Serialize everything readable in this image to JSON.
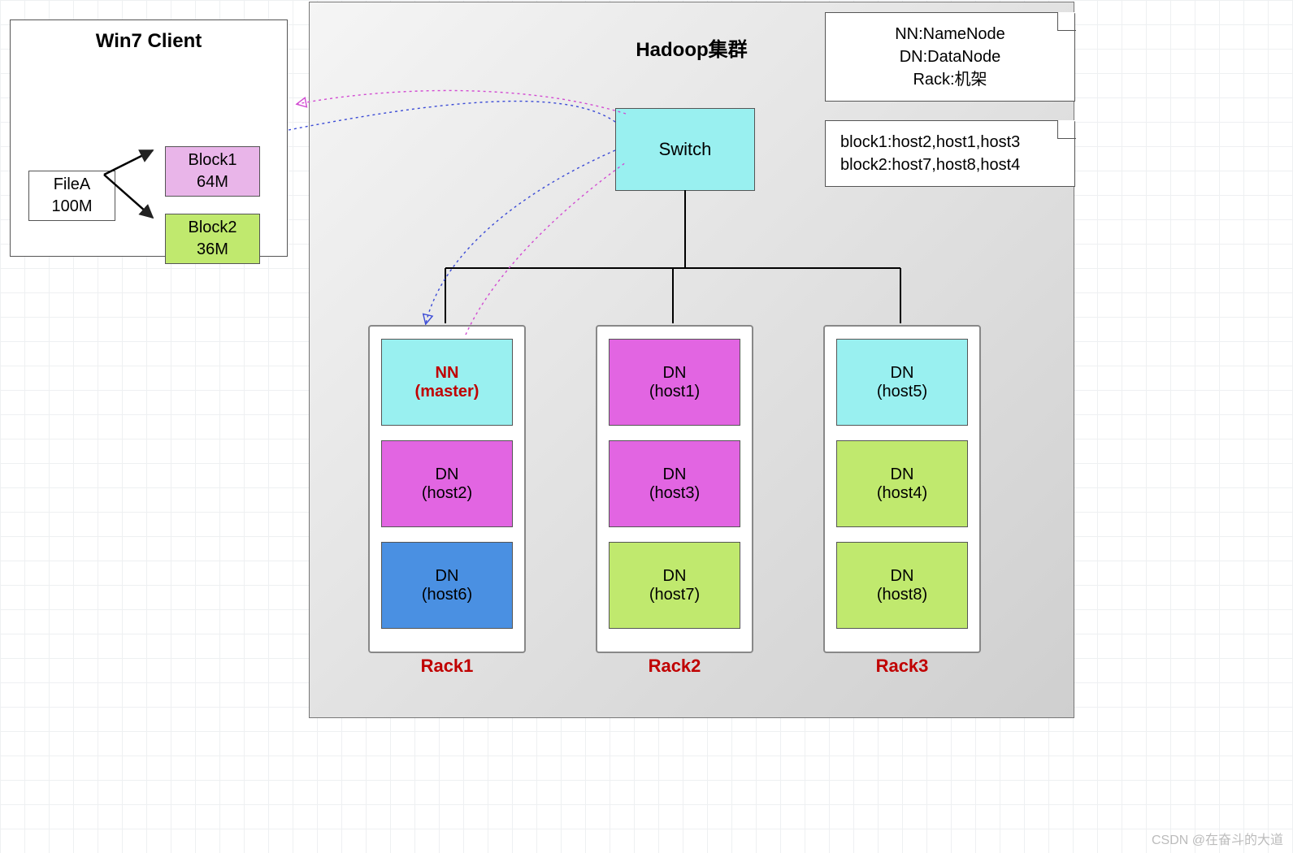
{
  "client": {
    "title": "Win7 Client",
    "file": {
      "name": "FileA",
      "size": "100M"
    },
    "blocks": [
      {
        "name": "Block1",
        "size": "64M",
        "color": "#e9b5e9"
      },
      {
        "name": "Block2",
        "size": "36M",
        "color": "#c0e96e"
      }
    ]
  },
  "cluster": {
    "title": "Hadoop集群",
    "switch": "Switch",
    "legend": {
      "lines": [
        "NN:NameNode",
        "DN:DataNode",
        "Rack:机架"
      ]
    },
    "mapping": {
      "lines": [
        "block1:host2,host1,host3",
        "block2:host7,host8,host4"
      ]
    },
    "racks": [
      {
        "label": "Rack1",
        "nodes": [
          {
            "line1": "NN",
            "line2": "(master)",
            "color": "#99f0f0",
            "master": true
          },
          {
            "line1": "DN",
            "line2": "(host2)",
            "color": "#e265e2"
          },
          {
            "line1": "DN",
            "line2": "(host6)",
            "color": "#4a90e2"
          }
        ]
      },
      {
        "label": "Rack2",
        "nodes": [
          {
            "line1": "DN",
            "line2": "(host1)",
            "color": "#e265e2"
          },
          {
            "line1": "DN",
            "line2": "(host3)",
            "color": "#e265e2"
          },
          {
            "line1": "DN",
            "line2": "(host7)",
            "color": "#c0e96e"
          }
        ]
      },
      {
        "label": "Rack3",
        "nodes": [
          {
            "line1": "DN",
            "line2": "(host5)",
            "color": "#99f0f0"
          },
          {
            "line1": "DN",
            "line2": "(host4)",
            "color": "#c0e96e"
          },
          {
            "line1": "DN",
            "line2": "(host8)",
            "color": "#c0e96e"
          }
        ]
      }
    ]
  },
  "watermark": "CSDN @在奋斗的大道"
}
